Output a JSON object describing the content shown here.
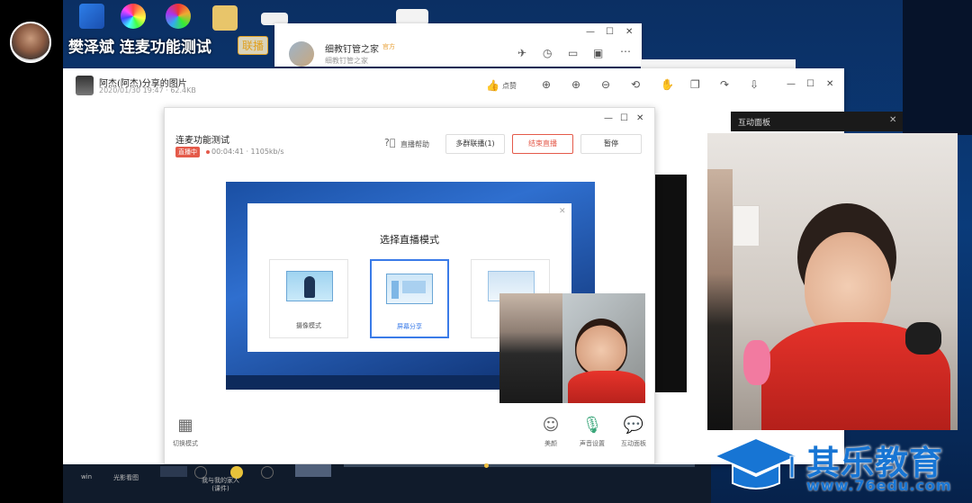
{
  "presenter": {
    "name": "樊泽斌 连麦功能测试",
    "badge": "联播"
  },
  "chat_window": {
    "name": "细教钉管之家",
    "tag": "官方",
    "sub": "细教钉管之家",
    "controls": [
      "—",
      "☐",
      "✕"
    ]
  },
  "viewer": {
    "title": "阿杰(阿杰)分享的图片",
    "meta": "2020/01/30 19:47 · 62.4KB",
    "like_label": "点赞",
    "controls": [
      "—",
      "☐",
      "✕"
    ]
  },
  "live": {
    "title": "连麦功能测试",
    "status": "直播中",
    "time_rate": "00:04:41 · 1105kb/s",
    "help": "直播帮助",
    "multi_group": "多群联播(1)",
    "end_live": "结束直播",
    "pause": "暂停",
    "controls": [
      "—",
      "☐",
      "✕"
    ]
  },
  "mode_dialog": {
    "title": "选择直播模式",
    "modes": [
      "摄像模式",
      "屏幕分享",
      ""
    ]
  },
  "bottom_bar": {
    "switch_mode": "切换模式",
    "beauty": "美颜",
    "audio": "声音设置",
    "interact": "互动面板"
  },
  "interaction_panel": {
    "title": "互动面板"
  },
  "taskbar": {
    "items": [
      "win",
      "光影看图",
      "",
      "",
      "我与我的家人\n(课件)"
    ]
  },
  "watermark": {
    "name": "其乐教育",
    "url": "www.76edu.com"
  },
  "colors": {
    "accent": "#e45a4a",
    "brand": "#1775d4",
    "select": "#3a7be8"
  }
}
